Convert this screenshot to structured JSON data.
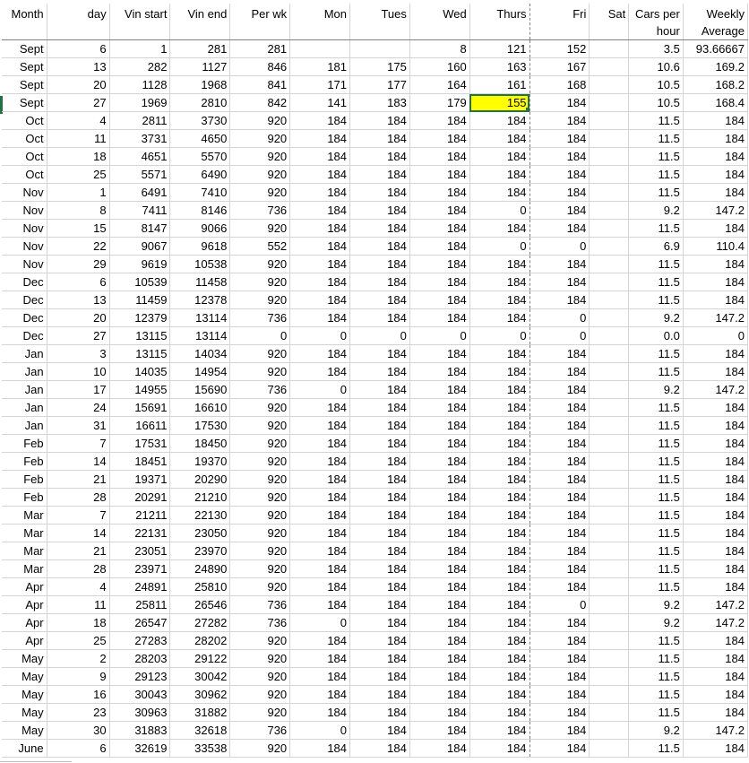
{
  "headers": [
    "Month",
    "day",
    "Vin start",
    "Vin end",
    "Per wk",
    "Mon",
    "Tues",
    "Wed",
    "Thurs",
    "Fri",
    "Sat",
    "Cars per hour",
    "Weekly Average"
  ],
  "header_cars_line1": "Cars per",
  "header_cars_line2": "hour",
  "header_avg_line1": "Weekly",
  "header_avg_line2": "Average",
  "selected_cell": {
    "row": 3,
    "column": "Thurs",
    "value": "155",
    "fill": "#ffff00"
  },
  "rows": [
    [
      "Sept",
      "6",
      "1",
      "281",
      "281",
      "",
      "",
      "8",
      "121",
      "152",
      "",
      "3.5",
      "93.66667"
    ],
    [
      "Sept",
      "13",
      "282",
      "1127",
      "846",
      "181",
      "175",
      "160",
      "163",
      "167",
      "",
      "10.6",
      "169.2"
    ],
    [
      "Sept",
      "20",
      "1128",
      "1968",
      "841",
      "171",
      "177",
      "164",
      "161",
      "168",
      "",
      "10.5",
      "168.2"
    ],
    [
      "Sept",
      "27",
      "1969",
      "2810",
      "842",
      "141",
      "183",
      "179",
      "155",
      "184",
      "",
      "10.5",
      "168.4"
    ],
    [
      "Oct",
      "4",
      "2811",
      "3730",
      "920",
      "184",
      "184",
      "184",
      "184",
      "184",
      "",
      "11.5",
      "184"
    ],
    [
      "Oct",
      "11",
      "3731",
      "4650",
      "920",
      "184",
      "184",
      "184",
      "184",
      "184",
      "",
      "11.5",
      "184"
    ],
    [
      "Oct",
      "18",
      "4651",
      "5570",
      "920",
      "184",
      "184",
      "184",
      "184",
      "184",
      "",
      "11.5",
      "184"
    ],
    [
      "Oct",
      "25",
      "5571",
      "6490",
      "920",
      "184",
      "184",
      "184",
      "184",
      "184",
      "",
      "11.5",
      "184"
    ],
    [
      "Nov",
      "1",
      "6491",
      "7410",
      "920",
      "184",
      "184",
      "184",
      "184",
      "184",
      "",
      "11.5",
      "184"
    ],
    [
      "Nov",
      "8",
      "7411",
      "8146",
      "736",
      "184",
      "184",
      "184",
      "0",
      "184",
      "",
      "9.2",
      "147.2"
    ],
    [
      "Nov",
      "15",
      "8147",
      "9066",
      "920",
      "184",
      "184",
      "184",
      "184",
      "184",
      "",
      "11.5",
      "184"
    ],
    [
      "Nov",
      "22",
      "9067",
      "9618",
      "552",
      "184",
      "184",
      "184",
      "0",
      "0",
      "",
      "6.9",
      "110.4"
    ],
    [
      "Nov",
      "29",
      "9619",
      "10538",
      "920",
      "184",
      "184",
      "184",
      "184",
      "184",
      "",
      "11.5",
      "184"
    ],
    [
      "Dec",
      "6",
      "10539",
      "11458",
      "920",
      "184",
      "184",
      "184",
      "184",
      "184",
      "",
      "11.5",
      "184"
    ],
    [
      "Dec",
      "13",
      "11459",
      "12378",
      "920",
      "184",
      "184",
      "184",
      "184",
      "184",
      "",
      "11.5",
      "184"
    ],
    [
      "Dec",
      "20",
      "12379",
      "13114",
      "736",
      "184",
      "184",
      "184",
      "184",
      "0",
      "",
      "9.2",
      "147.2"
    ],
    [
      "Dec",
      "27",
      "13115",
      "13114",
      "0",
      "0",
      "0",
      "0",
      "0",
      "0",
      "",
      "0.0",
      "0"
    ],
    [
      "Jan",
      "3",
      "13115",
      "14034",
      "920",
      "184",
      "184",
      "184",
      "184",
      "184",
      "",
      "11.5",
      "184"
    ],
    [
      "Jan",
      "10",
      "14035",
      "14954",
      "920",
      "184",
      "184",
      "184",
      "184",
      "184",
      "",
      "11.5",
      "184"
    ],
    [
      "Jan",
      "17",
      "14955",
      "15690",
      "736",
      "0",
      "184",
      "184",
      "184",
      "184",
      "",
      "9.2",
      "147.2"
    ],
    [
      "Jan",
      "24",
      "15691",
      "16610",
      "920",
      "184",
      "184",
      "184",
      "184",
      "184",
      "",
      "11.5",
      "184"
    ],
    [
      "Jan",
      "31",
      "16611",
      "17530",
      "920",
      "184",
      "184",
      "184",
      "184",
      "184",
      "",
      "11.5",
      "184"
    ],
    [
      "Feb",
      "7",
      "17531",
      "18450",
      "920",
      "184",
      "184",
      "184",
      "184",
      "184",
      "",
      "11.5",
      "184"
    ],
    [
      "Feb",
      "14",
      "18451",
      "19370",
      "920",
      "184",
      "184",
      "184",
      "184",
      "184",
      "",
      "11.5",
      "184"
    ],
    [
      "Feb",
      "21",
      "19371",
      "20290",
      "920",
      "184",
      "184",
      "184",
      "184",
      "184",
      "",
      "11.5",
      "184"
    ],
    [
      "Feb",
      "28",
      "20291",
      "21210",
      "920",
      "184",
      "184",
      "184",
      "184",
      "184",
      "",
      "11.5",
      "184"
    ],
    [
      "Mar",
      "7",
      "21211",
      "22130",
      "920",
      "184",
      "184",
      "184",
      "184",
      "184",
      "",
      "11.5",
      "184"
    ],
    [
      "Mar",
      "14",
      "22131",
      "23050",
      "920",
      "184",
      "184",
      "184",
      "184",
      "184",
      "",
      "11.5",
      "184"
    ],
    [
      "Mar",
      "21",
      "23051",
      "23970",
      "920",
      "184",
      "184",
      "184",
      "184",
      "184",
      "",
      "11.5",
      "184"
    ],
    [
      "Mar",
      "28",
      "23971",
      "24890",
      "920",
      "184",
      "184",
      "184",
      "184",
      "184",
      "",
      "11.5",
      "184"
    ],
    [
      "Apr",
      "4",
      "24891",
      "25810",
      "920",
      "184",
      "184",
      "184",
      "184",
      "184",
      "",
      "11.5",
      "184"
    ],
    [
      "Apr",
      "11",
      "25811",
      "26546",
      "736",
      "184",
      "184",
      "184",
      "184",
      "0",
      "",
      "9.2",
      "147.2"
    ],
    [
      "Apr",
      "18",
      "26547",
      "27282",
      "736",
      "0",
      "184",
      "184",
      "184",
      "184",
      "",
      "9.2",
      "147.2"
    ],
    [
      "Apr",
      "25",
      "27283",
      "28202",
      "920",
      "184",
      "184",
      "184",
      "184",
      "184",
      "",
      "11.5",
      "184"
    ],
    [
      "May",
      "2",
      "28203",
      "29122",
      "920",
      "184",
      "184",
      "184",
      "184",
      "184",
      "",
      "11.5",
      "184"
    ],
    [
      "May",
      "9",
      "29123",
      "30042",
      "920",
      "184",
      "184",
      "184",
      "184",
      "184",
      "",
      "11.5",
      "184"
    ],
    [
      "May",
      "16",
      "30043",
      "30962",
      "920",
      "184",
      "184",
      "184",
      "184",
      "184",
      "",
      "11.5",
      "184"
    ],
    [
      "May",
      "23",
      "30963",
      "31882",
      "920",
      "184",
      "184",
      "184",
      "184",
      "184",
      "",
      "11.5",
      "184"
    ],
    [
      "May",
      "30",
      "31883",
      "32618",
      "736",
      "0",
      "184",
      "184",
      "184",
      "184",
      "",
      "9.2",
      "147.2"
    ],
    [
      "June",
      "6",
      "32619",
      "33538",
      "920",
      "184",
      "184",
      "184",
      "184",
      "184",
      "",
      "11.5",
      "184"
    ]
  ]
}
